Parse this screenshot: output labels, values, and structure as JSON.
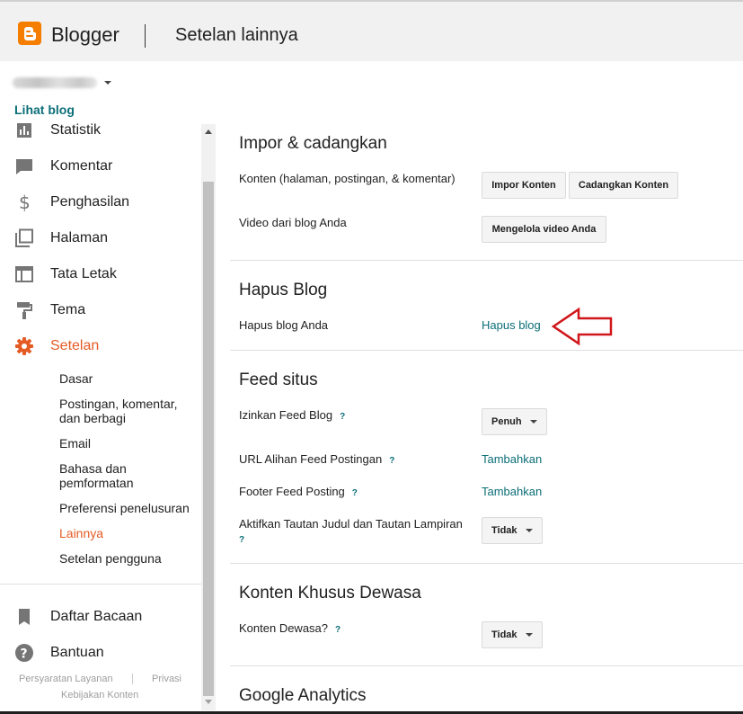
{
  "header": {
    "brand": "Blogger",
    "title": "Setelan lainnya"
  },
  "sidebar": {
    "view_blog": "Lihat blog",
    "nav": [
      {
        "label": "Statistik",
        "icon": "bar-chart-icon"
      },
      {
        "label": "Komentar",
        "icon": "comment-icon"
      },
      {
        "label": "Penghasilan",
        "icon": "dollar-icon"
      },
      {
        "label": "Halaman",
        "icon": "pages-icon"
      },
      {
        "label": "Tata Letak",
        "icon": "layout-icon"
      },
      {
        "label": "Tema",
        "icon": "paint-roller-icon"
      },
      {
        "label": "Setelan",
        "icon": "gear-icon"
      }
    ],
    "settings_sub": [
      {
        "label": "Dasar"
      },
      {
        "label": "Postingan, komentar, dan berbagi"
      },
      {
        "label": "Email"
      },
      {
        "label": "Bahasa dan pemformatan"
      },
      {
        "label": "Preferensi penelusuran"
      },
      {
        "label": "Lainnya"
      },
      {
        "label": "Setelan pengguna"
      }
    ],
    "bottom": [
      {
        "label": "Daftar Bacaan",
        "icon": "bookmark-icon"
      },
      {
        "label": "Bantuan",
        "icon": "help-icon"
      }
    ],
    "footer": {
      "terms": "Persyaratan Layanan",
      "privacy": "Privasi",
      "content_policy": "Kebijakan Konten"
    }
  },
  "main": {
    "import": {
      "title": "Impor & cadangkan",
      "content_label": "Konten (halaman, postingan, & komentar)",
      "import_btn": "Impor Konten",
      "backup_btn": "Cadangkan Konten",
      "video_label": "Video dari blog Anda",
      "video_btn": "Mengelola video Anda"
    },
    "delete": {
      "title": "Hapus Blog",
      "label": "Hapus blog Anda",
      "link": "Hapus blog"
    },
    "feed": {
      "title": "Feed situs",
      "allow_label": "Izinkan Feed Blog",
      "allow_value": "Penuh",
      "redirect_label": "URL Alihan Feed Postingan",
      "redirect_link": "Tambahkan",
      "footer_label": "Footer Feed Posting",
      "footer_link": "Tambahkan",
      "links_label": "Aktifkan Tautan Judul dan Tautan Lampiran",
      "links_value": "Tidak",
      "help": "?"
    },
    "adult": {
      "title": "Konten Khusus Dewasa",
      "label": "Konten Dewasa?",
      "value": "Tidak"
    },
    "analytics": {
      "title": "Google Analytics"
    }
  },
  "colors": {
    "accent": "#e45b25",
    "link": "#0b6e78",
    "logo": "#f57d00",
    "annotation_arrow": "#d0161a"
  }
}
